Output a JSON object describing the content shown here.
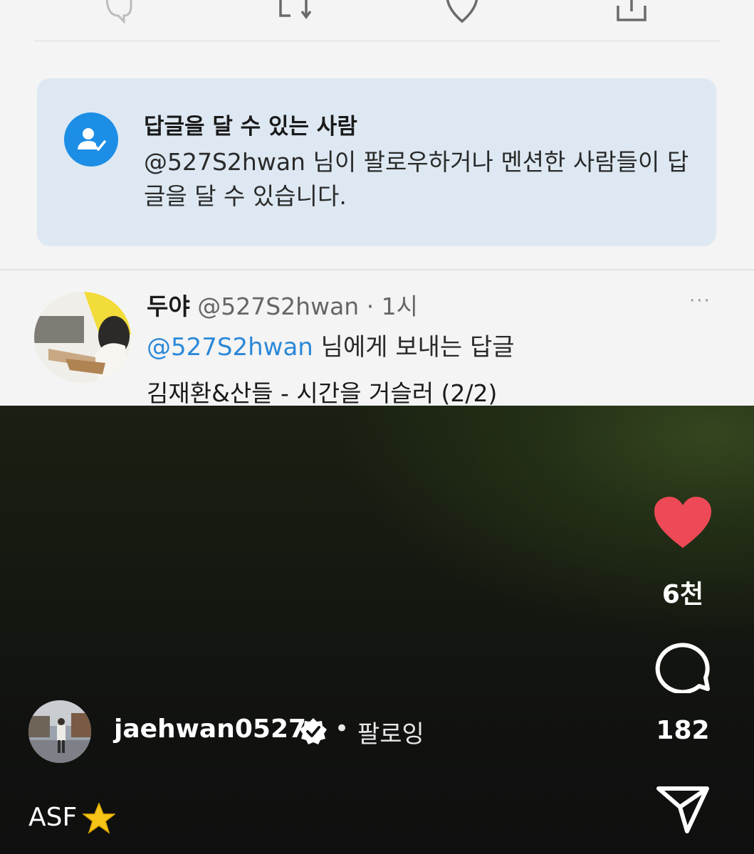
{
  "tweet_screenshot": {
    "action_icons": [
      "reply-icon",
      "retweet-icon",
      "like-icon",
      "share-icon"
    ],
    "reply_permission": {
      "title": "답글을 달 수 있는 사람",
      "description": "@527S2hwan 님이 팔로우하거나 멘션한 사람들이 답글을 달 수 있습니다."
    },
    "reply": {
      "display_name": "두야",
      "handle_time": "@527S2hwan · 1시",
      "more": "···",
      "replying_to_mention": "@527S2hwan",
      "replying_to_suffix": " 님에게 보내는 답글",
      "body": "김재환&산들 - 시간을 거슬러 (2/2)"
    }
  },
  "reel": {
    "like_count": "6천",
    "comment_count": "182",
    "username": "jaehwan0527",
    "separator": "•",
    "follow_label": "팔로잉",
    "caption_text": "ASF",
    "caption_emoji": "star",
    "colors": {
      "like": "#ed4956",
      "mention": "#2b88d8",
      "badge": "#1d8ee6"
    }
  }
}
